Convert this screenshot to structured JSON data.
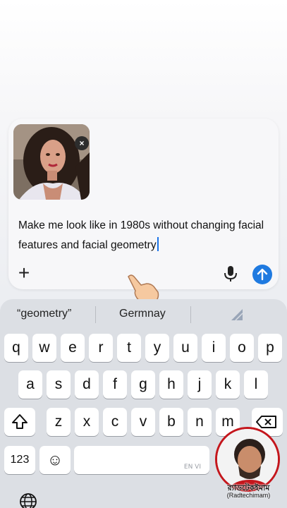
{
  "composer": {
    "prompt_text": "Make me look like in 1980s without changing facial features and facial geometry",
    "attachment_close": "×",
    "plus_label": "+"
  },
  "keyboard": {
    "suggestions": [
      "“geometry”",
      "Germnay"
    ],
    "row1": [
      "q",
      "w",
      "e",
      "r",
      "t",
      "y",
      "u",
      "i",
      "o",
      "p"
    ],
    "row2": [
      "a",
      "s",
      "d",
      "f",
      "g",
      "h",
      "j",
      "k",
      "l"
    ],
    "row3": [
      "z",
      "x",
      "c",
      "v",
      "b",
      "n",
      "m"
    ],
    "numbers_key": "123",
    "emoji_key": "☺",
    "space_lang_label": "EN VI"
  },
  "overlay": {
    "channel_name": "র‍্যাডটেকইমাম",
    "channel_handle": "(Radtechimam)"
  },
  "colors": {
    "accent": "#1f7ae0",
    "caret": "#1a73e8",
    "badge_ring": "#c4161c"
  }
}
